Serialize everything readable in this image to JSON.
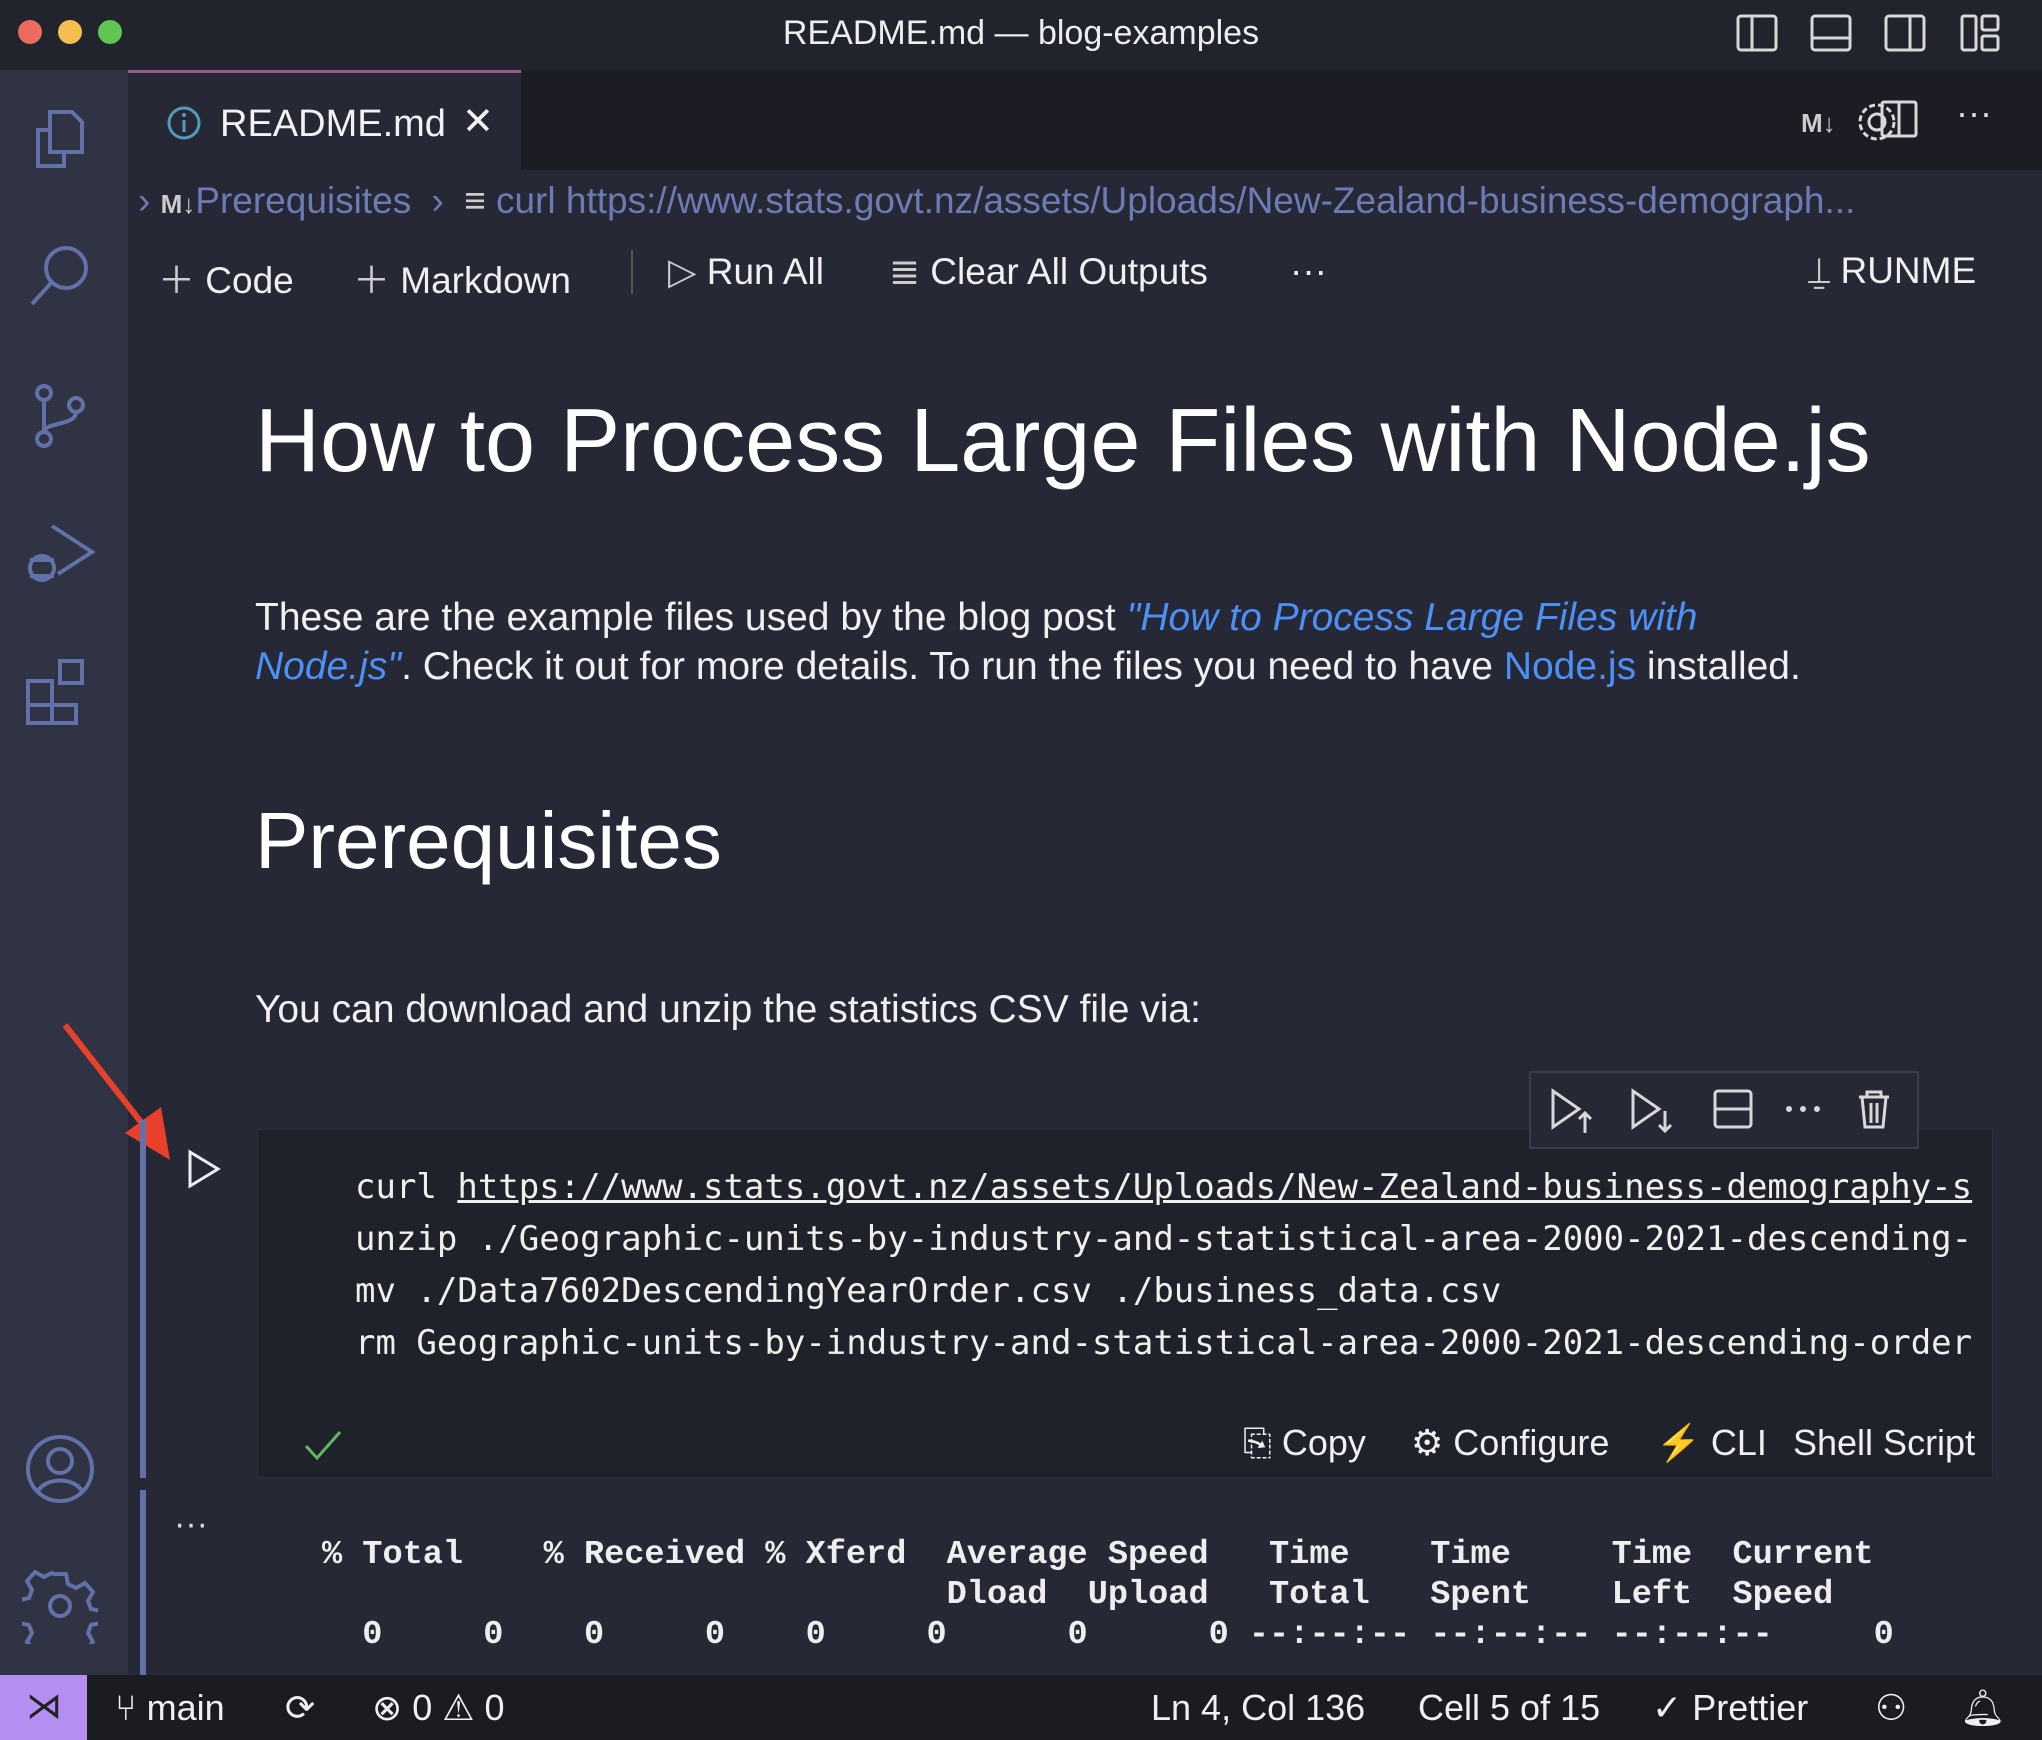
{
  "window": {
    "title": "README.md — blog-examples"
  },
  "tab": {
    "label": "README.md"
  },
  "breadcrumb": {
    "items": [
      "Prerequisites",
      "curl https://www.stats.govt.nz/assets/Uploads/New-Zealand-business-demograph..."
    ],
    "md_badge": "M↓"
  },
  "toolbar": {
    "code": "Code",
    "markdown": "Markdown",
    "run_all": "Run All",
    "clear": "Clear All Outputs",
    "more": "···",
    "runme": "RUNME",
    "md_badge": "M↓"
  },
  "doc": {
    "title": "How to Process Large Files with Node.js",
    "intro_1": "These are the example files used by the blog post ",
    "intro_link": "\"How to Process Large Files with",
    "intro_link2": "Node.js\"",
    "intro_2": ". Check it out for more details. To run the files you need to have ",
    "intro_node": "Node.js",
    "intro_3": " installed.",
    "h2": "Prerequisites",
    "para": "You can download and unzip the statistics CSV file via:"
  },
  "cell": {
    "lines": [
      {
        "cmd": "curl ",
        "url": "https://www.stats.govt.nz/assets/Uploads/New-Zealand-business-demography-s"
      },
      {
        "cmd": "unzip ./Geographic-units-by-industry-and-statistical-area-2000-2021-descending-"
      },
      {
        "cmd": "mv ./Data7602DescendingYearOrder.csv ./business_data.csv"
      },
      {
        "cmd": "rm Geographic-units-by-industry-and-statistical-area-2000-2021-descending-order"
      }
    ],
    "status": "success",
    "footer": {
      "copy": "Copy",
      "configure": "Configure",
      "cli": "CLI",
      "lang": "Shell Script"
    }
  },
  "output": {
    "more": "···",
    "text": "% Total    % Received % Xferd  Average Speed   Time    Time     Time  Current\n                               Dload  Upload   Total   Spent    Left  Speed\n  0     0    0     0    0     0      0      0 --:--:-- --:--:-- --:--:--     0"
  },
  "statusbar": {
    "branch": "main",
    "errors": "0",
    "warnings": "0",
    "position": "Ln 4, Col 136",
    "cell": "Cell 5 of 15",
    "formatter": "Prettier"
  },
  "colors": {
    "accent": "#b48ef0",
    "link": "#4c8ff5",
    "annotation_arrow": "#e8402a",
    "tab_border": "#9a5a8a"
  }
}
